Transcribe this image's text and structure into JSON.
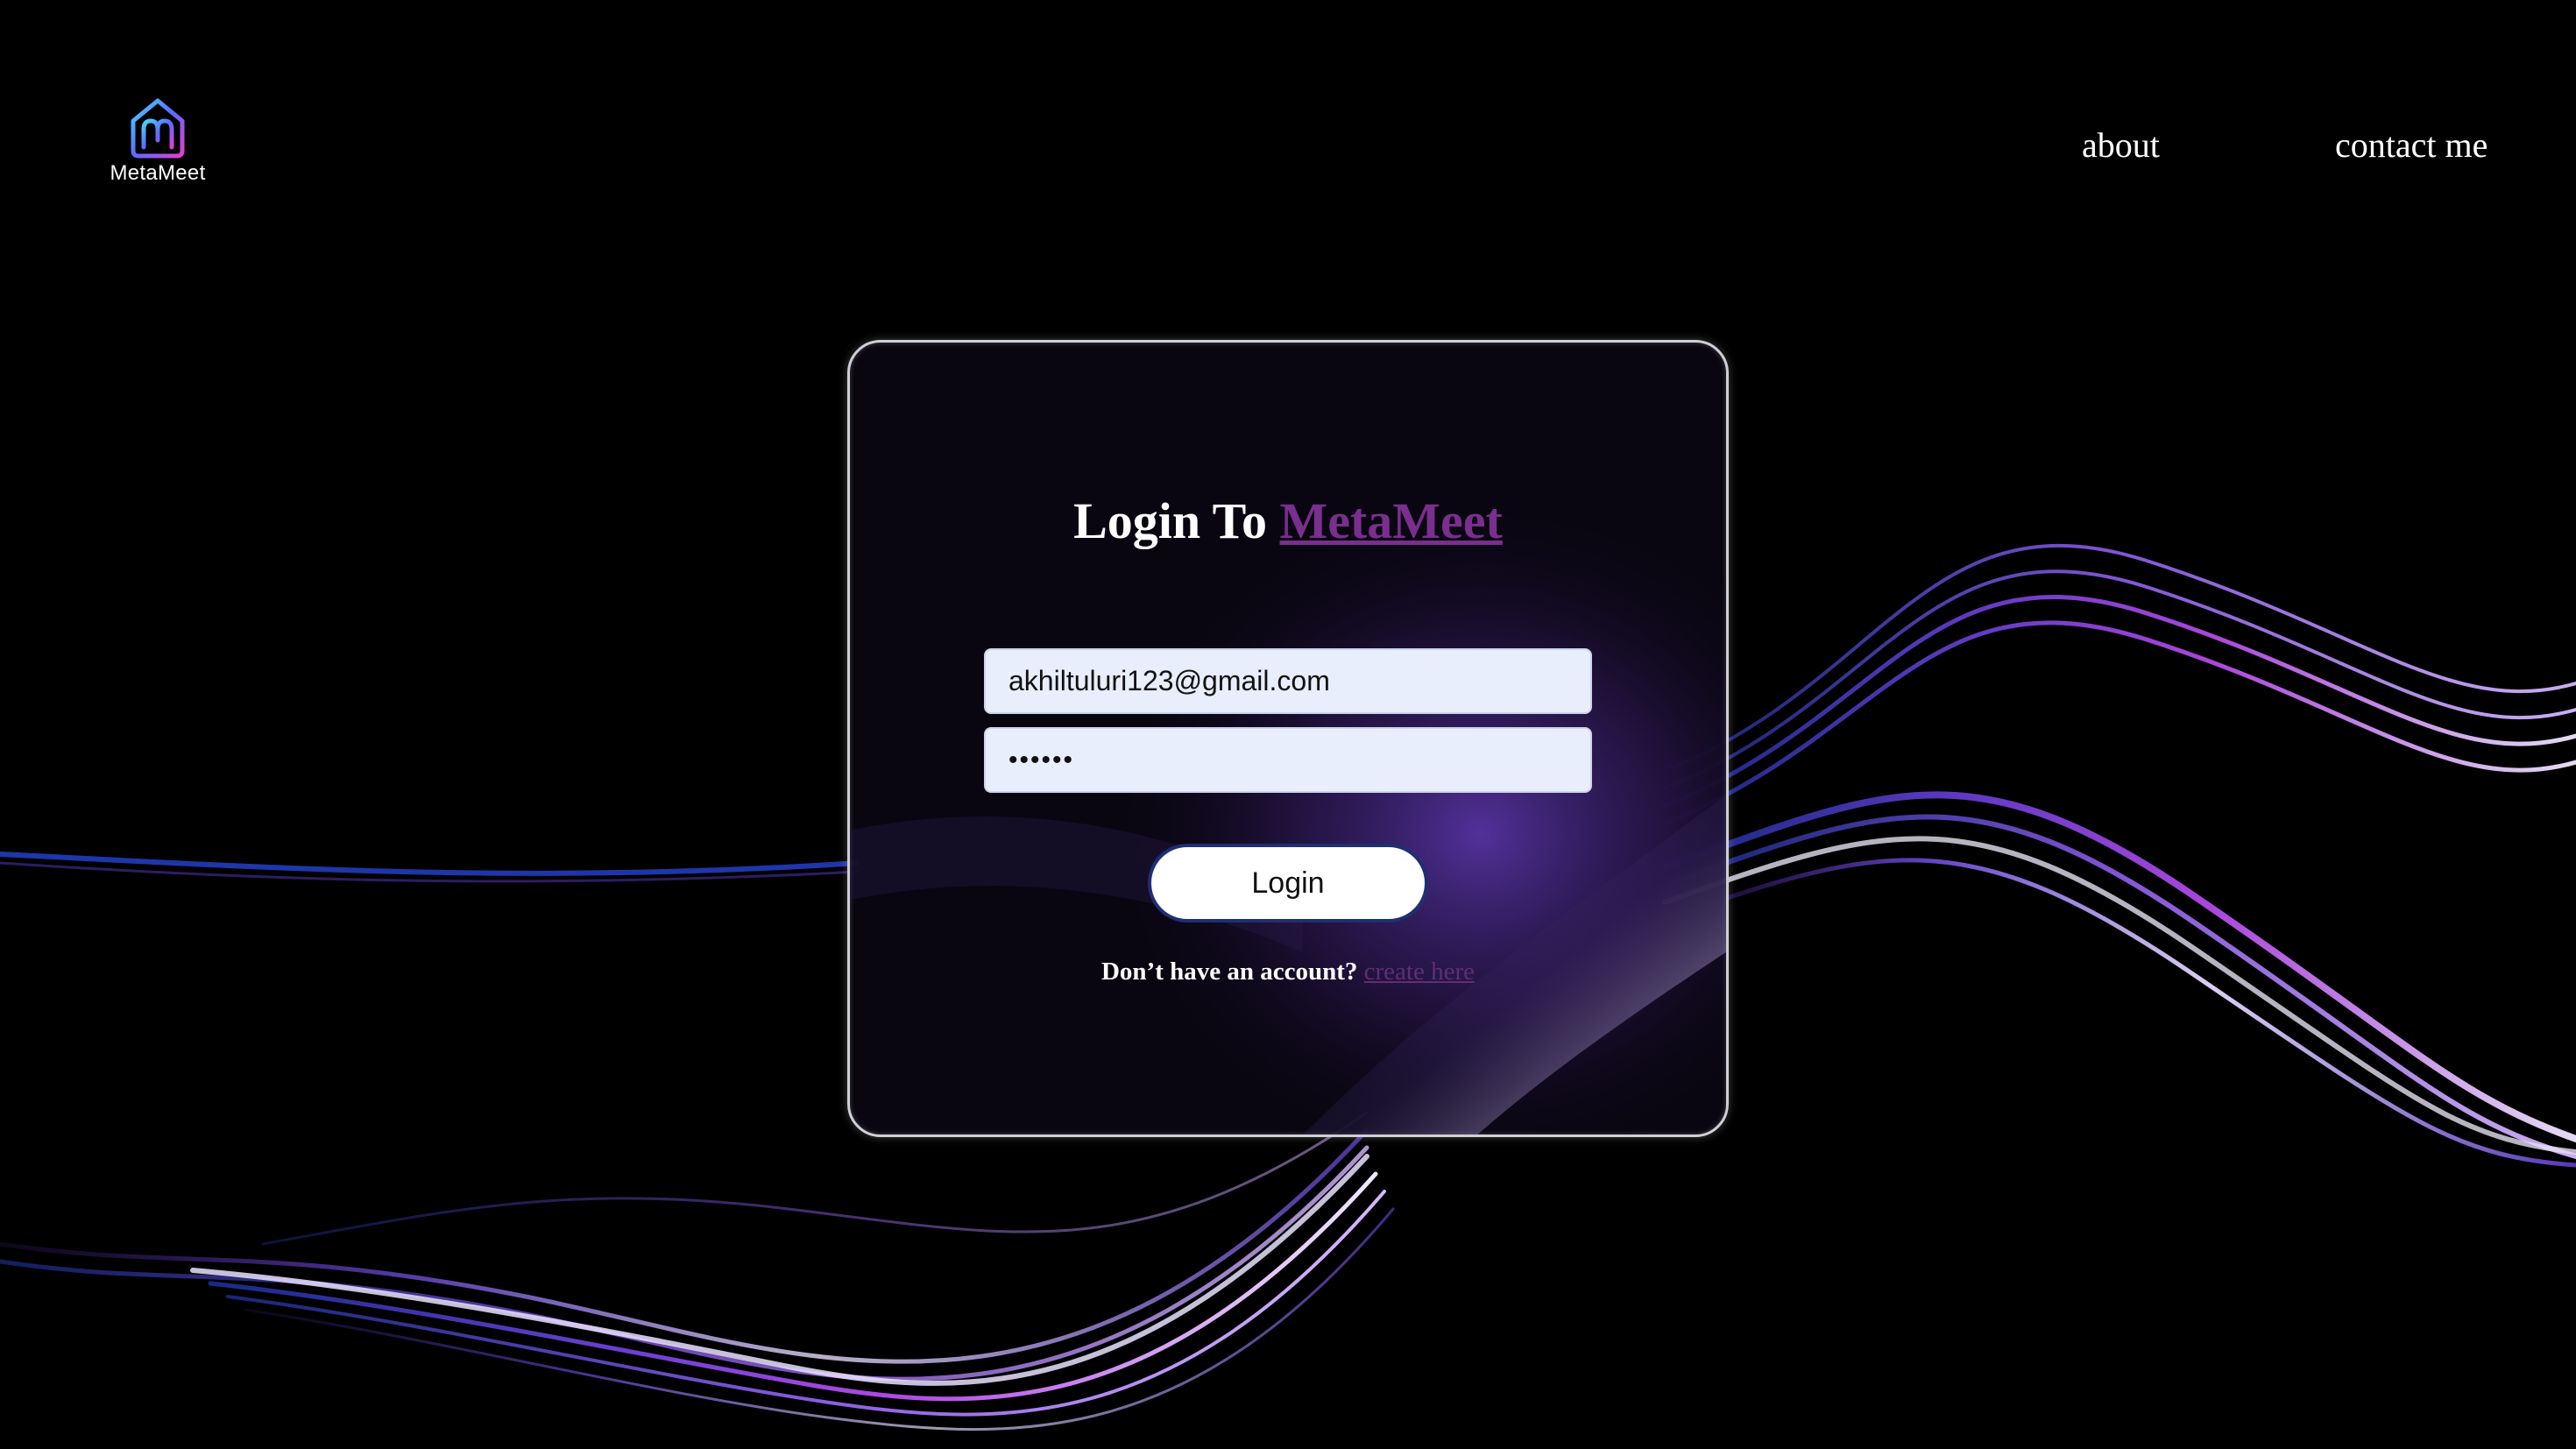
{
  "header": {
    "logo_text": "MetaMeet",
    "logo_icon": "metameet-house-icon",
    "nav": [
      {
        "label": "about"
      },
      {
        "label": "contact me"
      }
    ]
  },
  "login": {
    "title_prefix": "Login To",
    "title_brand": "MetaMeet",
    "email_value": "akhiltuluri123@gmail.com",
    "password_value": "••••••",
    "button_label": "Login",
    "signup_prompt": "Don’t have an account?",
    "signup_link": "create here"
  },
  "colors": {
    "background": "#000000",
    "brand_purple": "#7a2e8e",
    "input_bg": "#e8eefc",
    "button_border": "#1e2f73"
  }
}
